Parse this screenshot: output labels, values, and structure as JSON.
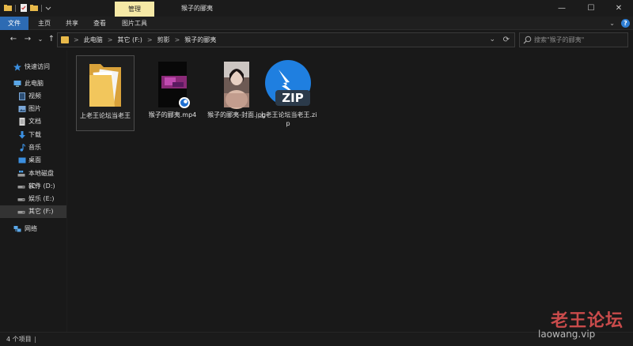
{
  "titlebar": {
    "manage_tab": "管理",
    "title": "猴子的郦夷",
    "minimize_glyph": "—",
    "maximize_glyph": "☐",
    "close_glyph": "✕"
  },
  "ribbon": {
    "tabs": [
      {
        "label": "文件"
      },
      {
        "label": "主页"
      },
      {
        "label": "共享"
      },
      {
        "label": "查看"
      },
      {
        "label": "图片工具"
      }
    ],
    "collapse_glyph": "⌄",
    "help_glyph": "?"
  },
  "nav": {
    "back_glyph": "←",
    "forward_glyph": "→",
    "recent_glyph": "⌄",
    "up_glyph": "↑"
  },
  "address": {
    "crumbs": [
      "此电脑",
      "其它 (F:)",
      "剪影",
      "猴子的郦夷"
    ],
    "separator": ">",
    "dropdown_glyph": "⌄",
    "refresh_glyph": "⟳"
  },
  "search": {
    "placeholder": "搜索\"猴子的郦夷\""
  },
  "sidebar": {
    "items": [
      {
        "label": "快速访问",
        "icon": "star-icon",
        "color": "#3b8fe0"
      },
      {
        "label": "此电脑",
        "icon": "computer-icon",
        "color": "#5aa7e8"
      },
      {
        "label": "视频",
        "icon": "video-icon",
        "color": "#7aa6d6"
      },
      {
        "label": "图片",
        "icon": "picture-icon",
        "color": "#7aa6d6"
      },
      {
        "label": "文档",
        "icon": "document-icon",
        "color": "#c9c9c9"
      },
      {
        "label": "下载",
        "icon": "download-icon",
        "color": "#3b8fe0"
      },
      {
        "label": "音乐",
        "icon": "music-icon",
        "color": "#3b8fe0"
      },
      {
        "label": "桌面",
        "icon": "desktop-icon",
        "color": "#3b8fe0"
      },
      {
        "label": "本地磁盘 (C:)",
        "icon": "windows-drive-icon",
        "color": "#8fb8e6"
      },
      {
        "label": "软件 (D:)",
        "icon": "drive-icon",
        "color": "#9a9a9a"
      },
      {
        "label": "娱乐 (E:)",
        "icon": "drive-icon",
        "color": "#9a9a9a"
      },
      {
        "label": "其它 (F:)",
        "icon": "drive-icon",
        "color": "#9a9a9a"
      },
      {
        "label": "网络",
        "icon": "network-icon",
        "color": "#5aa7e8"
      }
    ],
    "selected_index": 11
  },
  "files": [
    {
      "name": "上老王论坛当老王",
      "type": "folder",
      "icon": "folder-icon"
    },
    {
      "name": "猴子的郦夷.mp4",
      "type": "video",
      "icon": "video-thumbnail"
    },
    {
      "name": "猴子的郦夷-封面.jpg",
      "type": "image",
      "icon": "image-thumbnail"
    },
    {
      "name": "上老王论坛当老王.zip",
      "type": "zip",
      "icon": "zip-icon",
      "badge": "ZIP"
    }
  ],
  "status": {
    "count_text": "4 个项目"
  },
  "watermark": {
    "title": "老王论坛",
    "url": "laowang.vip"
  },
  "colors": {
    "accent": "#2d6bb3",
    "manage_tab_bg": "#f6e9a6",
    "watermark_red": "#c94b4b"
  }
}
